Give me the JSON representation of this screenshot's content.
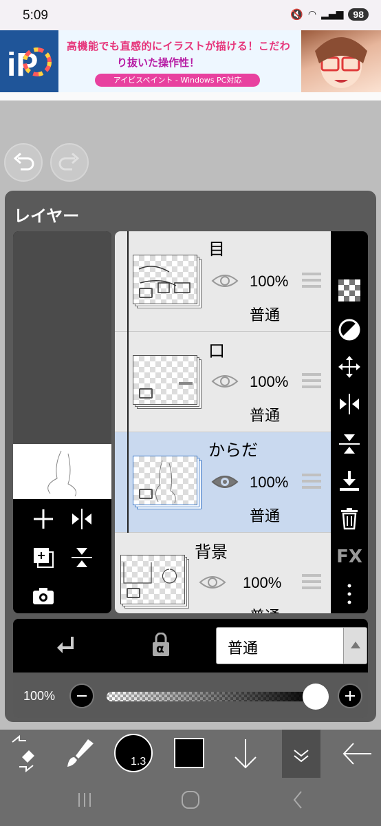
{
  "status": {
    "time": "5:09",
    "battery": "98"
  },
  "ad": {
    "line1": "高機能でも直感的にイラストが描ける！こだわ",
    "line2": "り抜いた操作性！",
    "pill": "アイビスペイント - Windows PC対応",
    "logo_text": "iP"
  },
  "panel": {
    "title": "レイヤー"
  },
  "layers": [
    {
      "name": "目",
      "opacity": "100%",
      "mode": "普通",
      "selected": false
    },
    {
      "name": "口",
      "opacity": "100%",
      "mode": "普通",
      "selected": false
    },
    {
      "name": "からだ",
      "opacity": "100%",
      "mode": "普通",
      "selected": true
    },
    {
      "name": "背景",
      "opacity": "100%",
      "mode": "普通",
      "selected": false
    }
  ],
  "right_tools": [
    "checker-icon",
    "invert-icon",
    "move-icon",
    "flip-horizontal-icon",
    "flip-vertical-icon",
    "merge-down-icon",
    "trash-icon",
    "fx-label",
    "more-icon"
  ],
  "fx_label": "FX",
  "blend": {
    "mode": "普通",
    "alpha_label": "α"
  },
  "opacity": {
    "value": "100%",
    "slider_fraction": 1.0
  },
  "brush": {
    "size": "1.3"
  },
  "colors": {
    "selected_layer": "#c9d9ef",
    "panel": "#5a5a5a",
    "accent": "#3b78c8"
  }
}
